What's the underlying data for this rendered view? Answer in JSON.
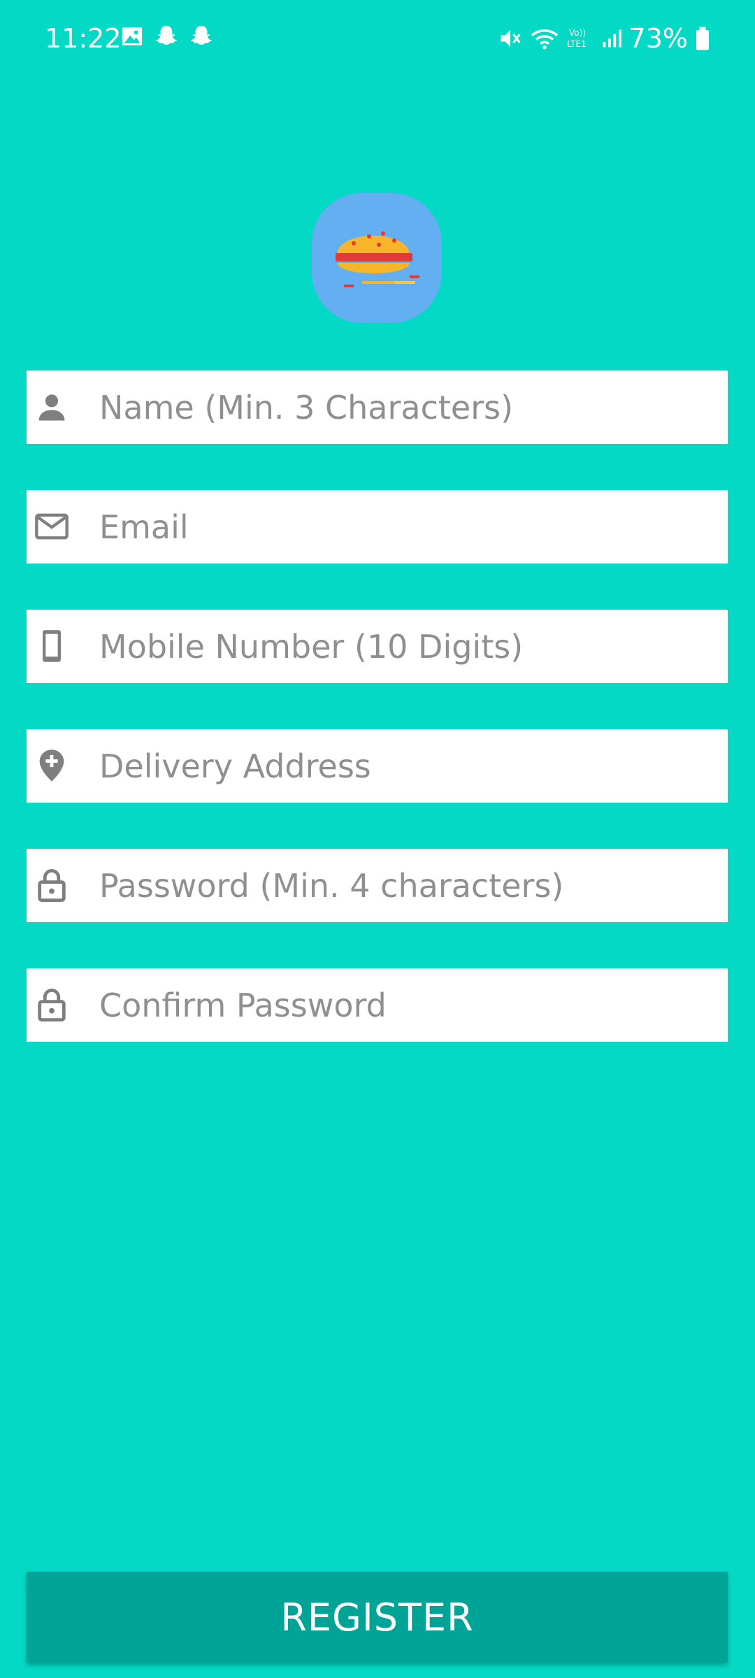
{
  "status_bar": {
    "time": "11:22",
    "battery": "73%",
    "network_label": "Vo)) LTE1",
    "icons": [
      "gallery-icon",
      "snapchat-icon",
      "snapchat-icon",
      "mute-icon",
      "wifi-icon",
      "volte-icon",
      "signal-icon",
      "battery-icon"
    ]
  },
  "logo": {
    "icon": "burger-icon",
    "background_color": "#64AEF2"
  },
  "form": {
    "fields": [
      {
        "icon": "person-icon",
        "placeholder": "Name (Min. 3 Characters)",
        "value": ""
      },
      {
        "icon": "mail-icon",
        "placeholder": "Email",
        "value": ""
      },
      {
        "icon": "phone-icon",
        "placeholder": "Mobile Number (10 Digits)",
        "value": ""
      },
      {
        "icon": "location-add-icon",
        "placeholder": "Delivery Address",
        "value": ""
      },
      {
        "icon": "lock-icon",
        "placeholder": "Password (Min. 4 characters)",
        "value": ""
      },
      {
        "icon": "lock-icon",
        "placeholder": "Confirm Password",
        "value": ""
      }
    ],
    "register_label": "REGISTER"
  },
  "colors": {
    "background": "#03D9C5",
    "button": "#00A497",
    "field_background": "#FFFFFF",
    "placeholder": "#8F8F8F",
    "icon": "#7F7F7F"
  }
}
